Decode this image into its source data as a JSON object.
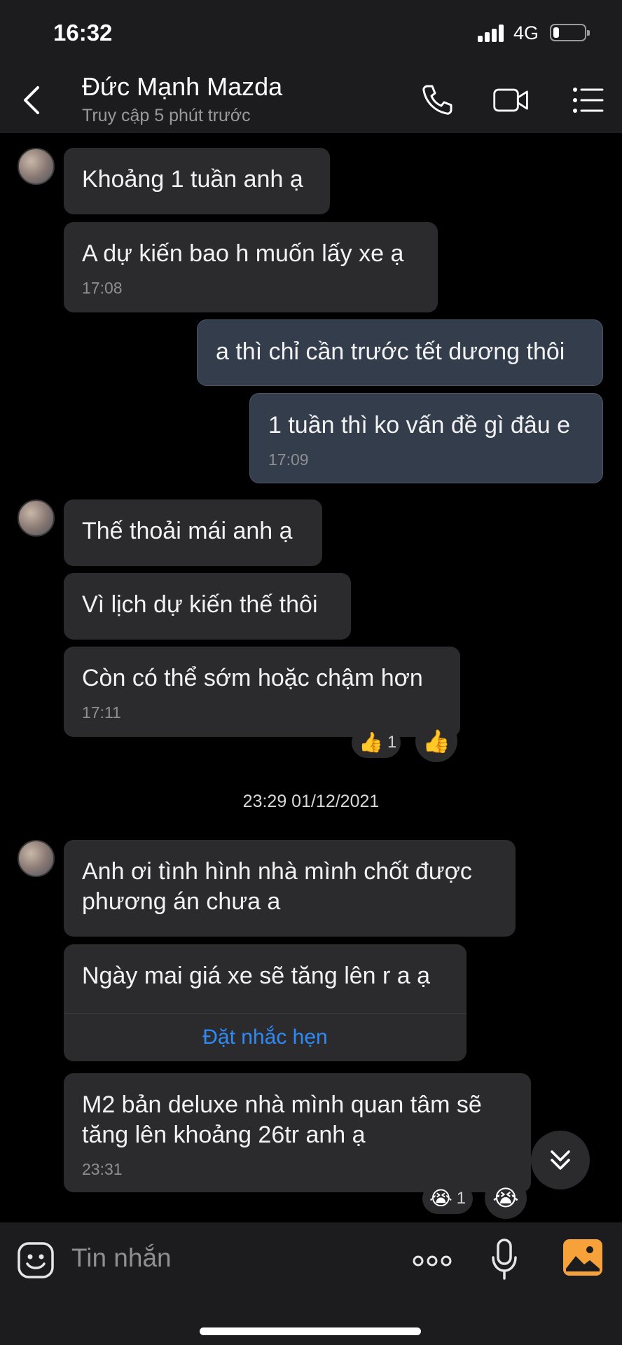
{
  "status_bar": {
    "time": "16:32",
    "network": "4G",
    "battery_level": 0.2
  },
  "header": {
    "contact_name": "Đức Mạnh Mazda",
    "contact_status": "Truy cập 5 phút trước",
    "icons": [
      "back-chevron-icon",
      "phone-icon",
      "video-call-icon",
      "menu-list-icon"
    ]
  },
  "messages": [
    {
      "from": "contact",
      "text": "Khoảng 1 tuần anh ạ"
    },
    {
      "from": "contact",
      "text": "A dự kiến bao h muốn lấy xe ạ",
      "time": "17:08"
    },
    {
      "from": "me",
      "text": "a thì chỉ cần trước tết dương thôi"
    },
    {
      "from": "me",
      "text": "1 tuần thì ko vấn đề gì đâu e",
      "time": "17:09"
    },
    {
      "from": "contact",
      "text": "Thế thoải mái anh ạ"
    },
    {
      "from": "contact",
      "text": "Vì lịch dự kiến thế thôi"
    },
    {
      "from": "contact",
      "text": "Còn có thể sớm hoặc chậm hơn",
      "time": "17:11",
      "reaction": {
        "emoji": "👍",
        "count": "1"
      }
    },
    {
      "from": "contact",
      "text": "Anh ơi tình hình nhà mình chốt được phương án chưa a"
    },
    {
      "from": "contact",
      "text": "Ngày mai giá xe sẽ tăng lên r a ạ",
      "action": "Đặt nhắc hẹn"
    },
    {
      "from": "contact",
      "text": "M2 bản deluxe nhà mình quan tâm sẽ tăng lên khoảng 26tr anh ạ",
      "time": "23:31",
      "reaction": {
        "emoji": "😭",
        "count": "1"
      }
    }
  ],
  "date_separator": "23:29 01/12/2021",
  "quick_reaction_icon": "thumbs-up-icon",
  "input_bar": {
    "placeholder": "Tin nhắn",
    "icons": [
      "sticker-icon",
      "more-icon",
      "microphone-icon",
      "image-icon"
    ]
  },
  "colors": {
    "background": "#000000",
    "incoming_bubble": "#2b2b2d",
    "outgoing_bubble": "#333d4c",
    "link": "#2e8af6",
    "image_icon": "#f7a13a"
  }
}
